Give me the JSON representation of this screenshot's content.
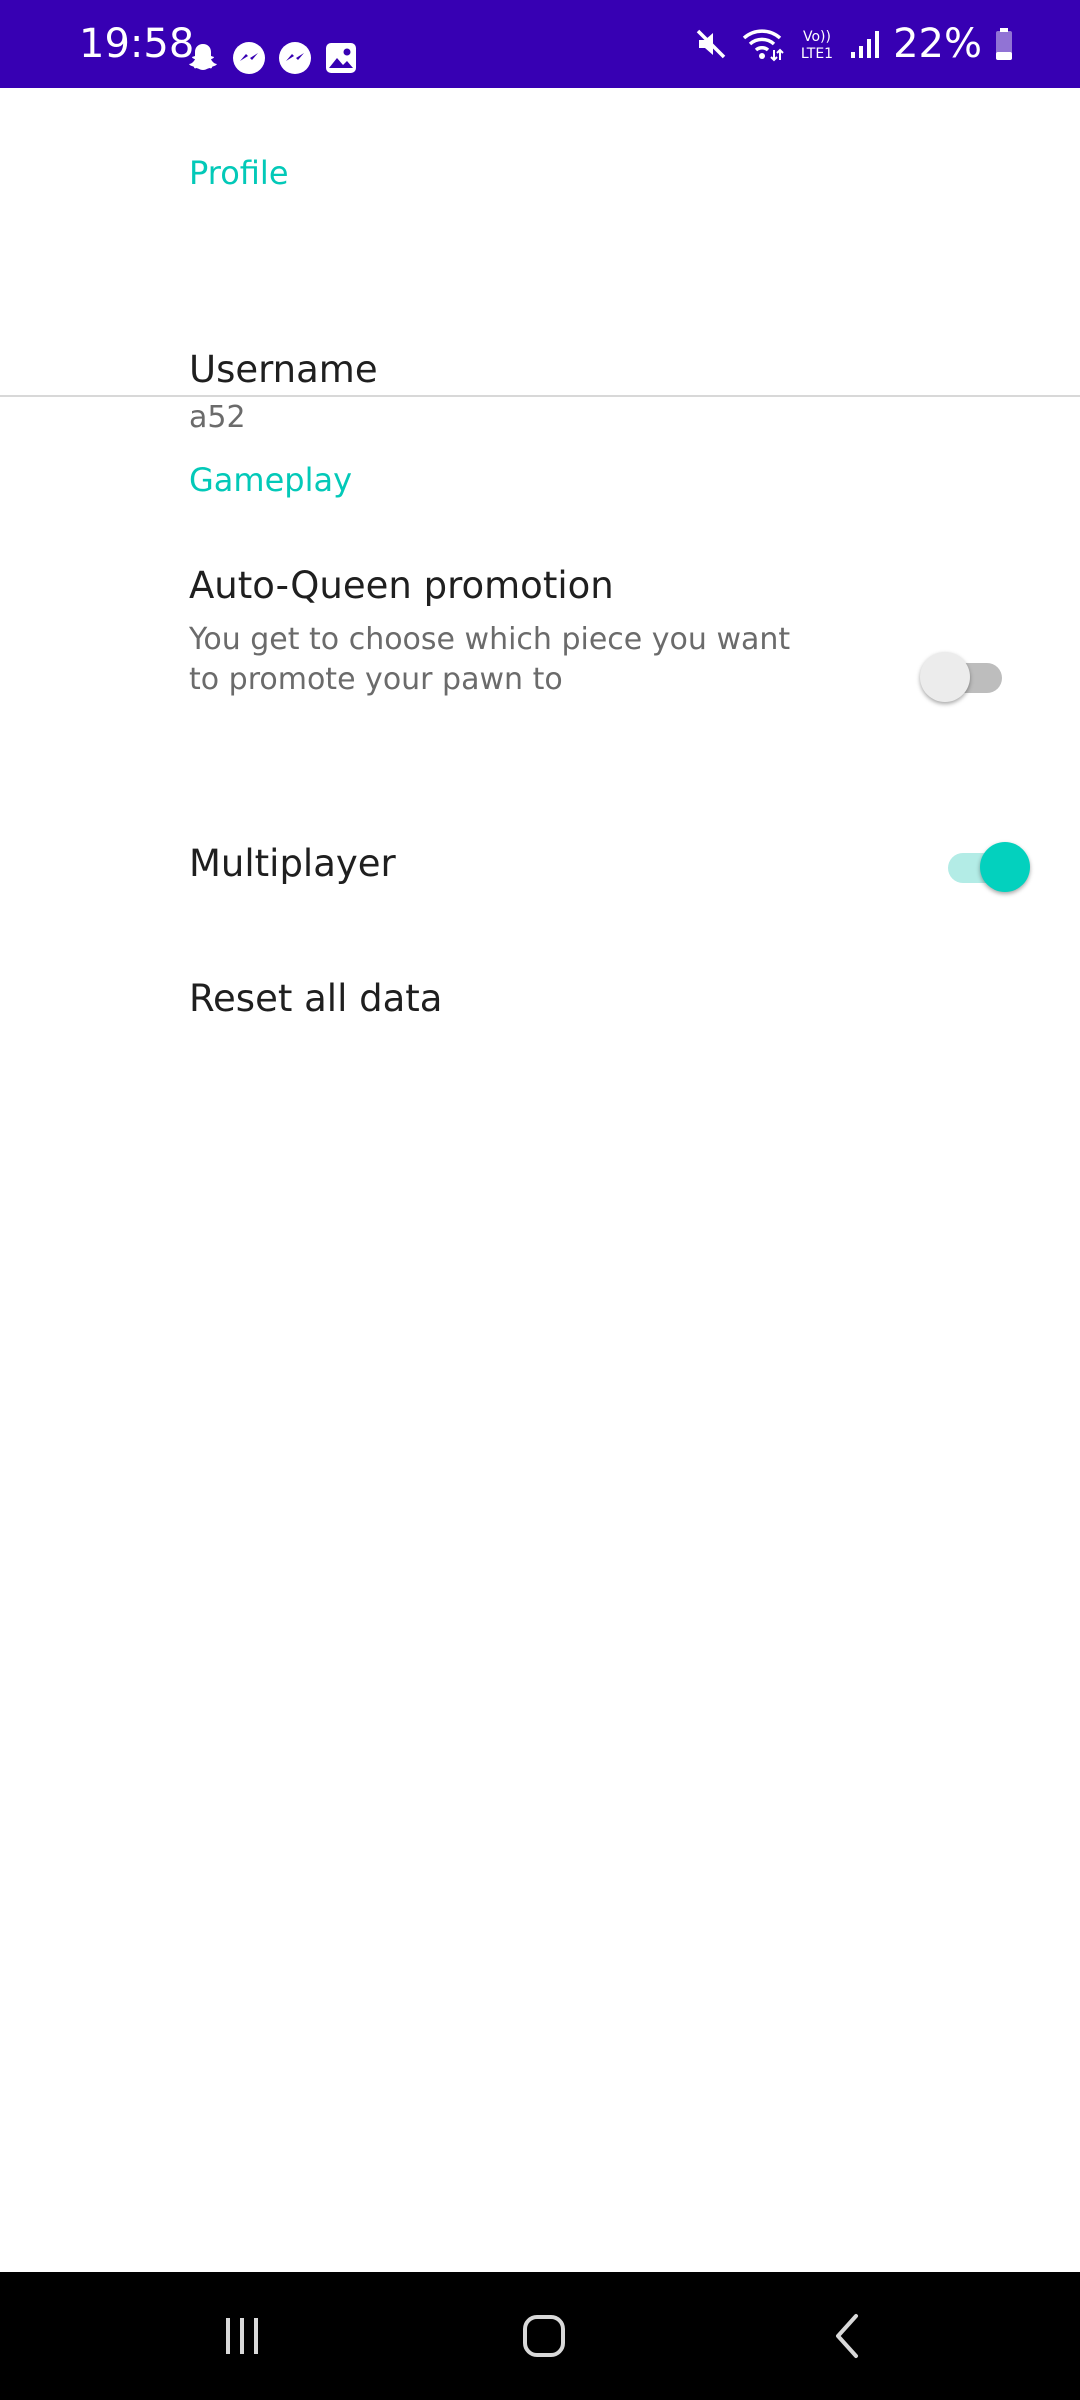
{
  "status_bar": {
    "time": "19:58",
    "battery_percent": "22%",
    "background_color": "#3700b3",
    "left_icons": [
      "snapchat-icon",
      "messenger-icon",
      "messenger-icon",
      "gallery-icon"
    ],
    "right_icons": [
      "mute-icon",
      "wifi-icon",
      "volte-icon",
      "signal-icon",
      "battery-icon"
    ],
    "volte_label_top": "Vo))",
    "volte_label_bottom": "LTE1"
  },
  "sections": {
    "profile": {
      "header": "Profile",
      "username": {
        "title": "Username",
        "value": "a52"
      }
    },
    "gameplay": {
      "header": "Gameplay",
      "auto_queen": {
        "title": "Auto-Queen promotion",
        "summary": "You get to choose which piece you want to promote your pawn to",
        "enabled": false
      },
      "multiplayer": {
        "title": "Multiplayer",
        "enabled": true
      },
      "reset": {
        "title": "Reset all data"
      }
    }
  },
  "colors": {
    "accent": "#03c9b8",
    "switch_on": "#03d1be",
    "switch_off": "#ececec"
  },
  "nav_bar": {
    "buttons": [
      "recents-icon",
      "home-icon",
      "back-icon"
    ]
  }
}
